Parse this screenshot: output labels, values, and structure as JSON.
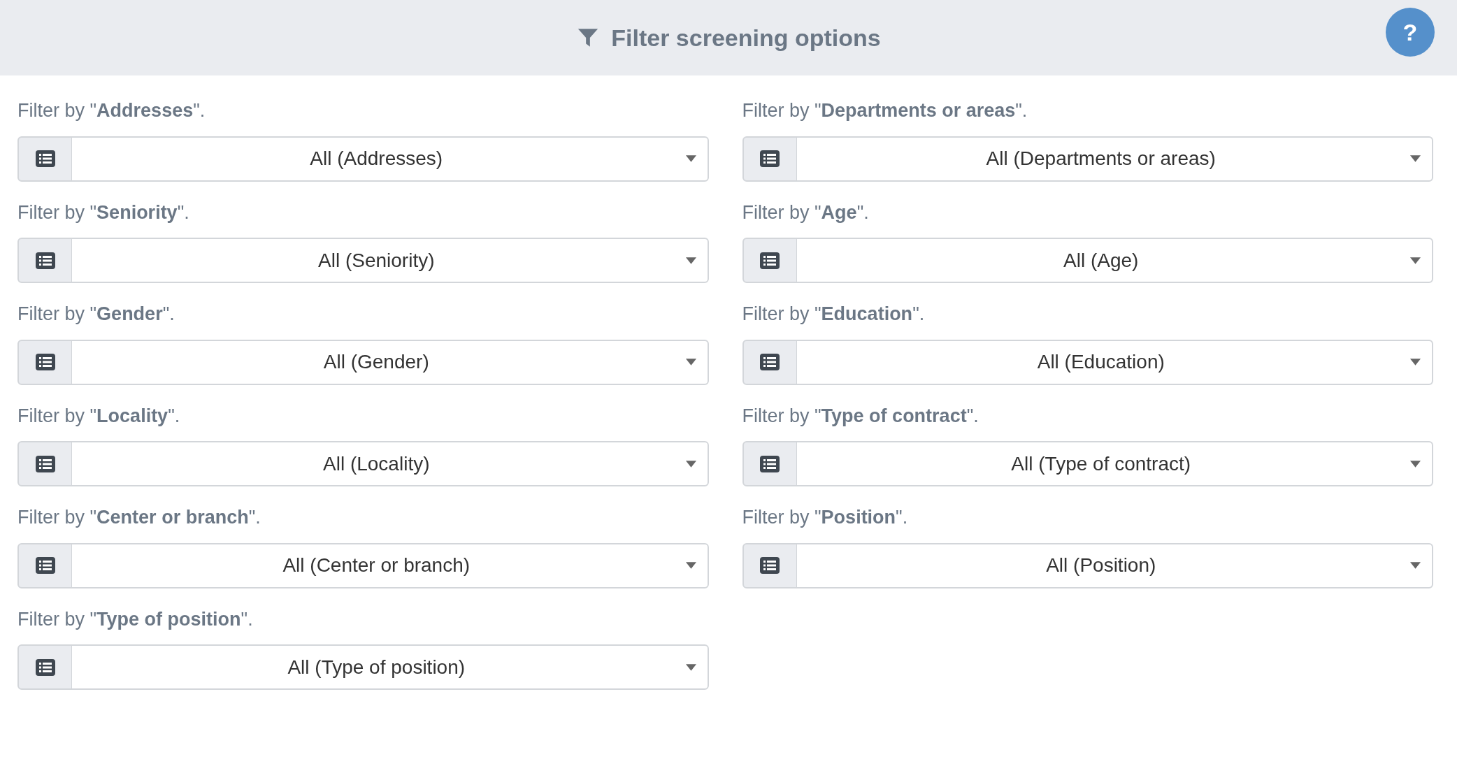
{
  "header": {
    "title": "Filter screening options",
    "help": "?"
  },
  "filters": [
    {
      "label": "Filter by \"**Addresses**\".",
      "value": "All (Addresses)"
    },
    {
      "label": "Filter by \"**Departments or areas**\".",
      "value": "All (Departments or areas)"
    },
    {
      "label": "Filter by \"**Seniority**\".",
      "value": "All (Seniority)"
    },
    {
      "label": "Filter by \"**Age**\".",
      "value": "All (Age)"
    },
    {
      "label": "Filter by \"**Gender**\".",
      "value": "All (Gender)"
    },
    {
      "label": "Filter by \"**Education**\".",
      "value": "All (Education)"
    },
    {
      "label": "Filter by \"**Locality**\".",
      "value": "All (Locality)"
    },
    {
      "label": "Filter by \"**Type of contract**\".",
      "value": "All (Type of contract)"
    },
    {
      "label": "Filter by \"**Center or branch**\".",
      "value": "All (Center or branch)"
    },
    {
      "label": "Filter by \"**Position**\".",
      "value": "All (Position)"
    },
    {
      "label": "Filter by \"**Type of position**\".",
      "value": "All (Type of position)"
    }
  ]
}
